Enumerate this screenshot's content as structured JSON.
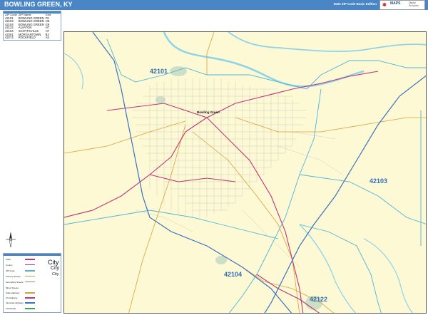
{
  "header": {
    "title": "BOWLING GREEN, KY",
    "edition": "2022 ZIP Code Basic Edition",
    "logo_text": "MAPS",
    "logo_sub": "Digital Products"
  },
  "zip_legend": {
    "columns": [
      "ZIP Code",
      "ZIP Name",
      "Grid"
    ],
    "rows": [
      {
        "zip": "42101",
        "name": "BOWLING GREEN",
        "grid": "F8"
      },
      {
        "zip": "42103",
        "name": "BOWLING GREEN",
        "grid": "H8"
      },
      {
        "zip": "42104",
        "name": "BOWLING GREEN",
        "grid": "G9"
      },
      {
        "zip": "42122",
        "name": "ALVATON",
        "grid": "H7"
      },
      {
        "zip": "42164",
        "name": "SCOTTSVILLE",
        "grid": "H7"
      },
      {
        "zip": "42261",
        "name": "MORGANTOWN",
        "grid": "B2"
      },
      {
        "zip": "42274",
        "name": "ROCKFIELD",
        "grid": "A5"
      }
    ]
  },
  "map_legend": {
    "items": [
      {
        "label": "State",
        "color": "#c0357a"
      },
      {
        "label": "County",
        "color": "#c0357a"
      },
      {
        "label": "ZIP Code",
        "color": "#4ab5d6"
      },
      {
        "label": "Primary Streets",
        "color": "#d9a13b"
      },
      {
        "label": "Secondary Streets",
        "color": "#888888"
      },
      {
        "label": "Minor Streets",
        "color": "#aaaaaa"
      },
      {
        "label": "State Highway",
        "color": "#d4a039"
      },
      {
        "label": "US Highway",
        "color": "#c0357a"
      },
      {
        "label": "Interstate Highway",
        "color": "#3a72c0"
      },
      {
        "label": "Toll Roads",
        "color": "#3aa844"
      }
    ],
    "city_labels": [
      "City",
      "City",
      "City"
    ]
  },
  "map": {
    "zip_labels": [
      "42101",
      "42103",
      "42104",
      "42122"
    ],
    "city_name": "Bowling Green",
    "colors": {
      "land": "#fdf9d5",
      "water": "#8fd3e8",
      "park": "#cde0c6",
      "interstate": "#3a72c0",
      "us_highway": "#c0357a",
      "zip_boundary": "#4ab5d6"
    }
  }
}
